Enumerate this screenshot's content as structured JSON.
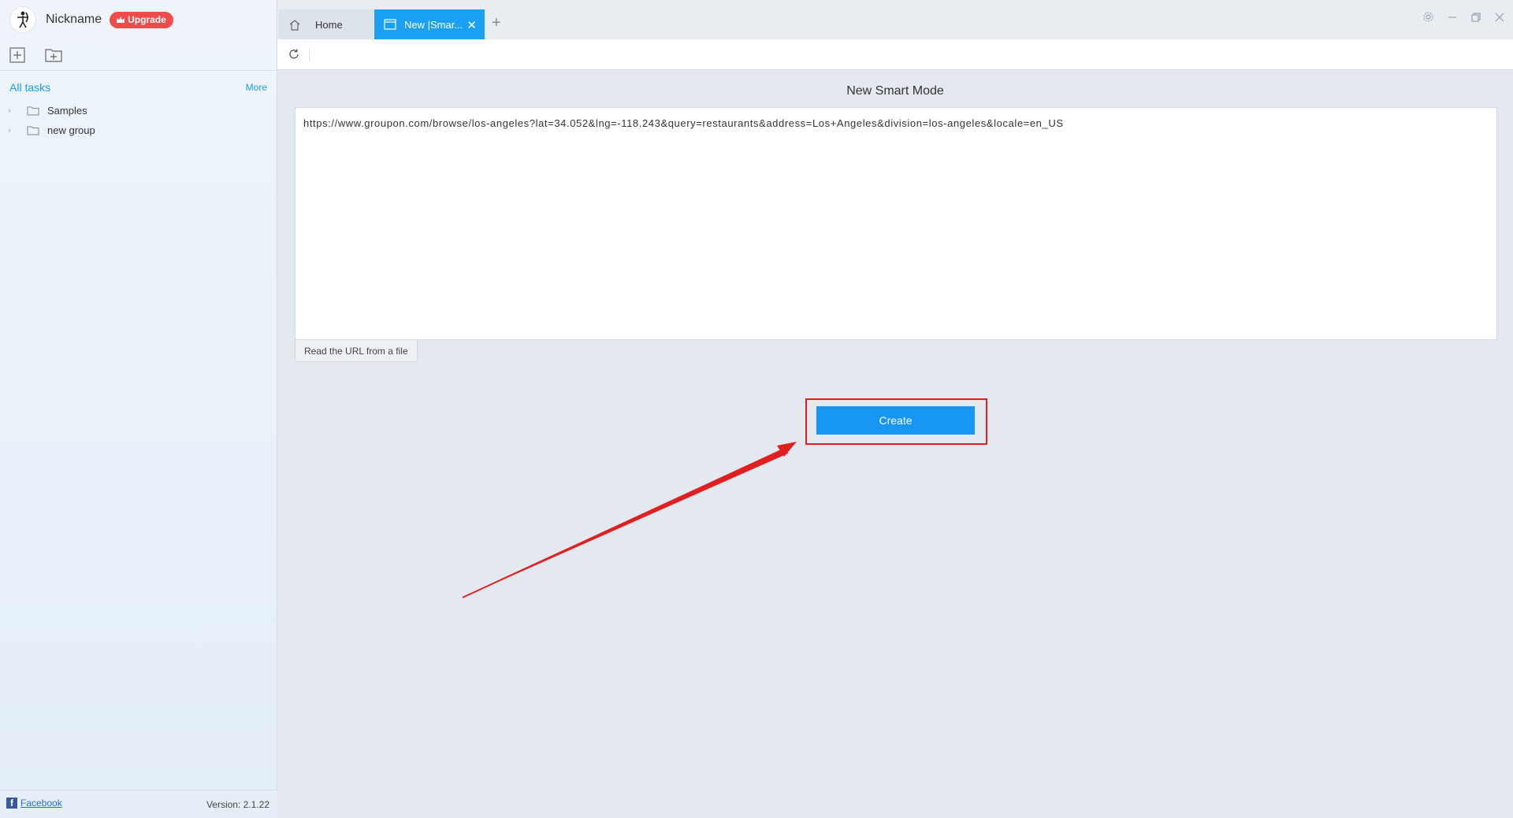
{
  "user": {
    "nickname": "Nickname",
    "upgrade_label": "Upgrade"
  },
  "sidebar": {
    "all_tasks_label": "All tasks",
    "more_label": "More",
    "groups": [
      {
        "label": "Samples"
      },
      {
        "label": "new group"
      }
    ],
    "footer": {
      "facebook_label": "Facebook",
      "version": "Version: 2.1.22"
    }
  },
  "tabs": {
    "home_label": "Home",
    "active_label": "New |Smar..."
  },
  "main": {
    "title": "New Smart Mode",
    "url_value": "https://www.groupon.com/browse/los-angeles?lat=34.052&lng=-118.243&query=restaurants&address=Los+Angeles&division=los-angeles&locale=en_US",
    "read_url_label": "Read the URL from a file",
    "create_label": "Create"
  },
  "colors": {
    "accent": "#1aa1f3",
    "upgrade_bg": "#f04b4b",
    "annotation_red": "#e02020"
  }
}
